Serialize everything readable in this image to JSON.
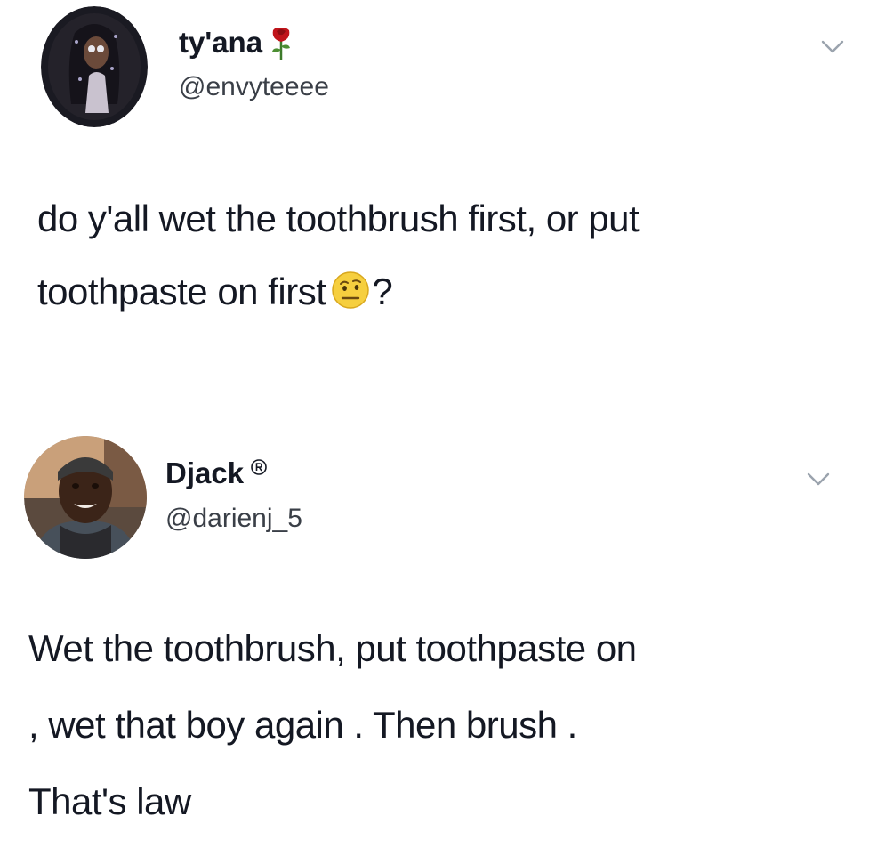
{
  "tweets": [
    {
      "display_name": "ty'ana",
      "name_icon": "rose-icon",
      "handle": "@envyteeee",
      "text_lines": [
        "do y'all wet the toothbrush first, or put",
        "toothpaste on first"
      ],
      "trailing_emoji": "raised-eyebrow-emoji-icon",
      "trailing_text": "?"
    },
    {
      "display_name": "Djack",
      "name_icon": "registered-icon",
      "handle": "@darienj_5",
      "text_lines": [
        "Wet the toothbrush, put toothpaste on",
        ", wet that boy again . Then brush .",
        "That's law"
      ]
    }
  ],
  "colors": {
    "text": "#141823",
    "secondary_text": "#3a3f47",
    "chevron": "#9aa3ad",
    "background": "#ffffff"
  }
}
